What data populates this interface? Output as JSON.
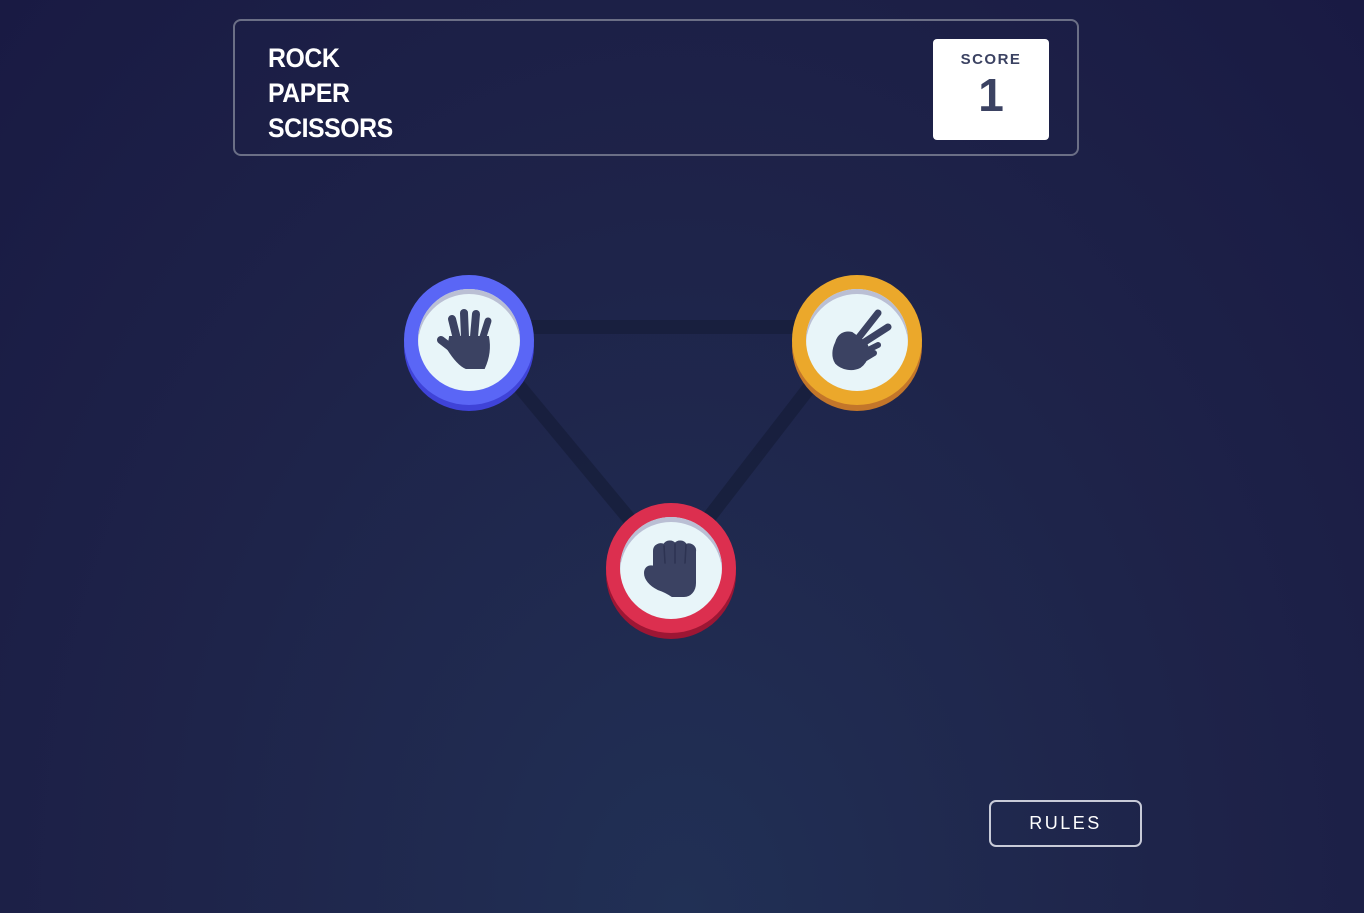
{
  "header": {
    "title_lines": [
      "ROCK",
      "PAPER",
      "SCISSORS"
    ],
    "score_label": "SCORE",
    "score_value": "1"
  },
  "choices": [
    {
      "id": "paper",
      "icon": "paper-hand-icon",
      "color": "#5a66f6"
    },
    {
      "id": "scissors",
      "icon": "scissors-hand-icon",
      "color": "#eba82b"
    },
    {
      "id": "rock",
      "icon": "rock-fist-icon",
      "color": "#dc2f4f"
    }
  ],
  "rules_button": {
    "label": "RULES"
  },
  "colors": {
    "background": "#1e2349",
    "icon": "#3b4262",
    "token_face": "#e8f5f9"
  }
}
